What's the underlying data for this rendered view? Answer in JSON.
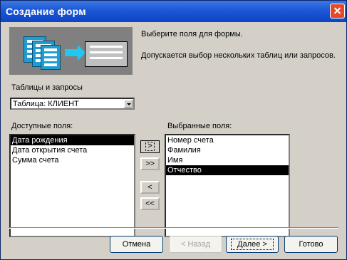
{
  "window": {
    "title": "Создание форм"
  },
  "intro": {
    "line1": "Выберите поля для формы.",
    "line2": "Допускается выбор нескольких таблиц или запросов."
  },
  "source": {
    "label": "Таблицы и запросы",
    "selected": "Таблица: КЛИЕНТ"
  },
  "available": {
    "label": "Доступные поля:",
    "items": [
      "Дата рождения",
      "Дата открытия счета",
      "Сумма счета"
    ],
    "selected_index": 0
  },
  "selected_fields": {
    "label": "Выбранные поля:",
    "items": [
      "Номер счета",
      "Фамилия",
      "Имя",
      "Отчество"
    ],
    "selected_index": 3
  },
  "move_buttons": {
    "add": ">",
    "add_all": ">>",
    "remove": "<",
    "remove_all": "<<"
  },
  "footer": {
    "cancel": "Отмена",
    "back": "< Назад",
    "next": "Далее >",
    "finish": "Готово"
  }
}
